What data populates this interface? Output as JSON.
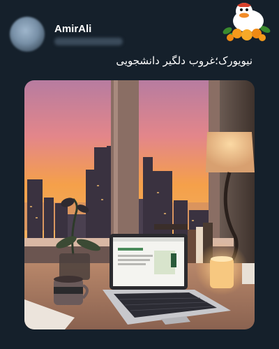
{
  "post": {
    "author_name": "AmirAli",
    "text": "نیویورک؛غروب دلگیر دانشجویی"
  },
  "icons": {
    "avatar": "profile-avatar",
    "sticker": "cartoon-duck-with-oranges"
  },
  "colors": {
    "background": "#15202b",
    "sky_top": "#c97a8a",
    "sky_bottom": "#f6a24b",
    "lamp_glow": "#f8c88a"
  }
}
